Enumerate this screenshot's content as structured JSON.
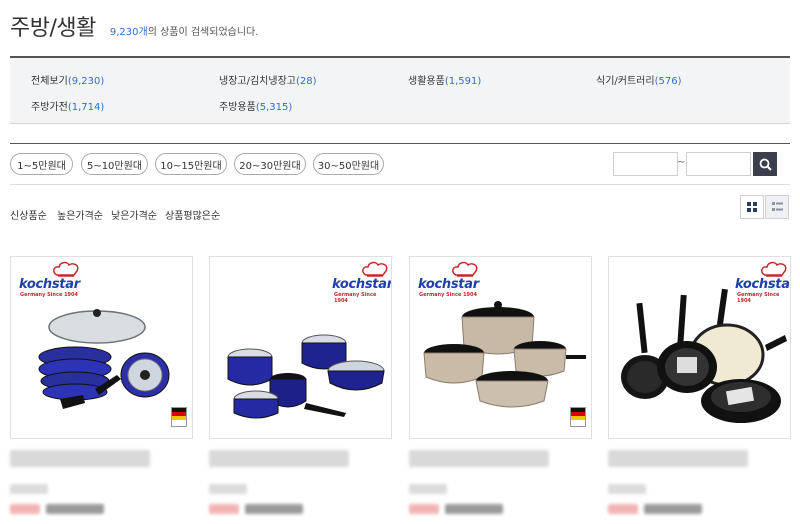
{
  "header": {
    "title": "주방/생활",
    "count": "9,230개",
    "count_suffix": "의 상품이 검색되었습니다."
  },
  "categories": [
    {
      "label": "전체보기",
      "count": "(9,230)"
    },
    {
      "label": "냉장고/김치냉장고",
      "count": "(28)"
    },
    {
      "label": "생활용품",
      "count": "(1,591)"
    },
    {
      "label": "식기/커트러리",
      "count": "(576)"
    },
    {
      "label": "주방가전",
      "count": "(1,714)"
    },
    {
      "label": "주방용품",
      "count": "(5,315)"
    }
  ],
  "price_chips": [
    "1~5만원대",
    "5~10만원대",
    "10~15만원대",
    "20~30만원대",
    "30~50만원대"
  ],
  "price_range": {
    "separator": "~",
    "min_value": "",
    "max_value": ""
  },
  "sort_options": [
    "신상품순",
    "높은가격순",
    "낮은가격순",
    "상품평많은순"
  ],
  "view_modes": {
    "grid_icon": "grid-view-icon",
    "list_icon": "list-view-icon",
    "active": "grid"
  },
  "products": [
    {
      "brand": "kochstar",
      "brand_sub": "Germany Since 1904",
      "style": "blue-set"
    },
    {
      "brand": "kochstar",
      "brand_sub": "Germany Since 1904",
      "style": "blue-enamel"
    },
    {
      "brand": "kochstar",
      "brand_sub": "Germany Since 1904",
      "style": "beige-pots"
    },
    {
      "brand": "kochstar",
      "brand_sub": "Germany Since 1904",
      "style": "black-pans"
    }
  ],
  "colors": {
    "accent": "#2f6fc4",
    "brand_blue": "#1f3fa8",
    "brand_red": "#c62828",
    "search_button": "#3a3f4b"
  }
}
